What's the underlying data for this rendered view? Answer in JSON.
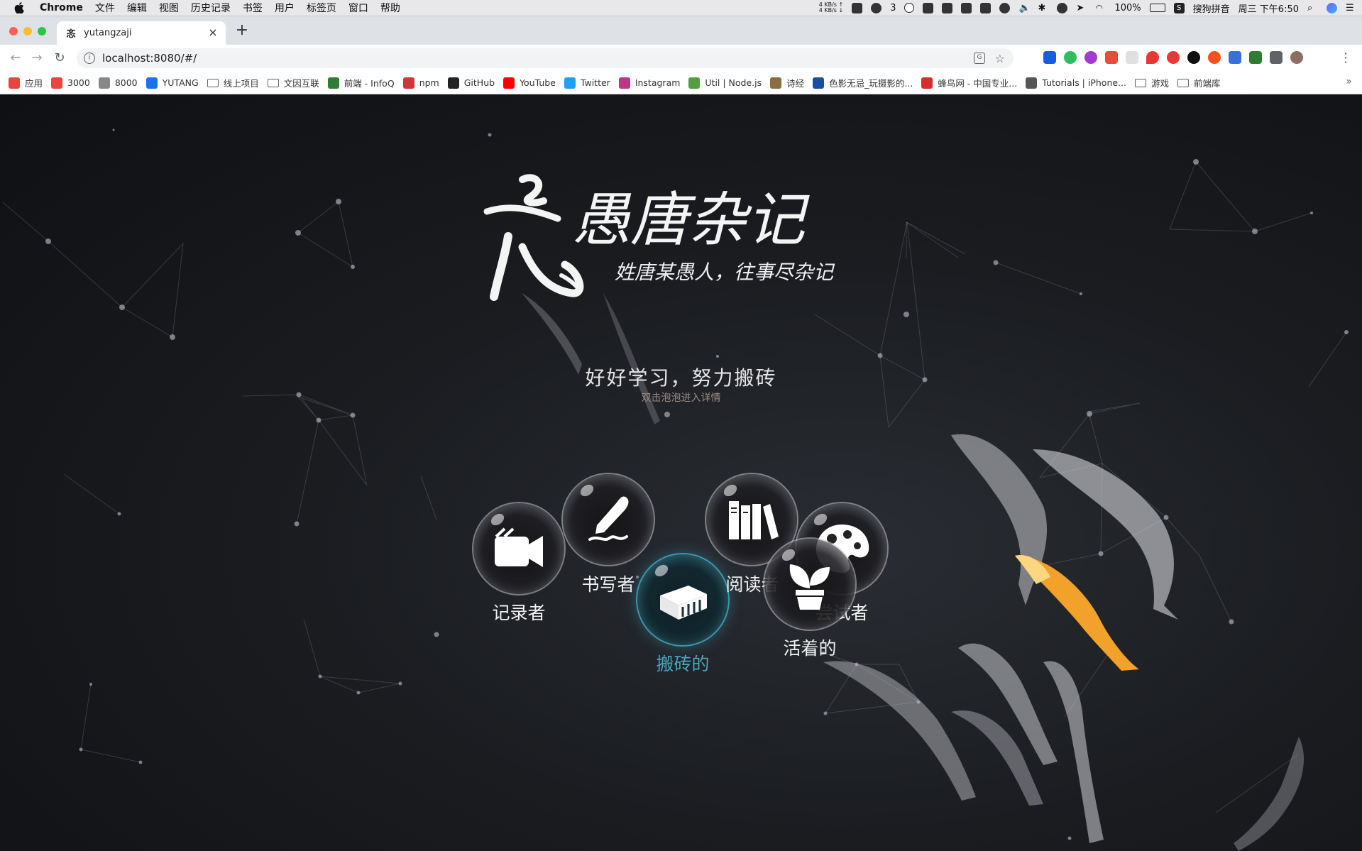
{
  "menubar": {
    "app": "Chrome",
    "items": [
      "文件",
      "编辑",
      "视图",
      "历史记录",
      "书签",
      "用户",
      "标签页",
      "窗口",
      "帮助"
    ],
    "net_up": "4 KB/s ↑",
    "net_down": "4 KB/s ↓",
    "wechat_count": "3",
    "battery": "100%",
    "input_method": "搜狗拼音",
    "clock": "周三 下午6:50"
  },
  "browser": {
    "tab_title": "yutangzaji",
    "tab_favicon": "忞",
    "url": "localhost:8080/#/"
  },
  "bookmarks": [
    {
      "label": "应用",
      "icon": "apps-grid",
      "color": "#e8453c"
    },
    {
      "label": "3000",
      "icon": "flame",
      "color": "#e8453c"
    },
    {
      "label": "8000",
      "icon": "dash",
      "color": "#888888"
    },
    {
      "label": "YUTANG",
      "icon": "dsm",
      "color": "#1a73e8"
    },
    {
      "label": "线上项目",
      "icon": "folder",
      "color": ""
    },
    {
      "label": "文因互联",
      "icon": "folder",
      "color": ""
    },
    {
      "label": "前端 - InfoQ",
      "icon": "infoq",
      "color": "#2e7d32"
    },
    {
      "label": "npm",
      "icon": "npm",
      "color": "#cb3837"
    },
    {
      "label": "GitHub",
      "icon": "github",
      "color": "#222222"
    },
    {
      "label": "YouTube",
      "icon": "youtube",
      "color": "#ff0000"
    },
    {
      "label": "Twitter",
      "icon": "twitter",
      "color": "#1da1f2"
    },
    {
      "label": "Instagram",
      "icon": "instagram",
      "color": "#c13584"
    },
    {
      "label": "Util | Node.js",
      "icon": "nodejs",
      "color": "#539e43"
    },
    {
      "label": "诗经",
      "icon": "poem",
      "color": "#8a6d3b"
    },
    {
      "label": "色影无忌_玩摄影的...",
      "icon": "xitek",
      "color": "#1a4fa0"
    },
    {
      "label": "蜂鸟网 - 中国专业...",
      "icon": "fengniao",
      "color": "#d32f2f"
    },
    {
      "label": "Tutorials | iPhone...",
      "icon": "tutorials",
      "color": "#555555"
    },
    {
      "label": "游戏",
      "icon": "folder",
      "color": ""
    },
    {
      "label": "前端库",
      "icon": "folder",
      "color": ""
    }
  ],
  "hero": {
    "logo_title": "愚唐杂记",
    "logo_tagline": "姓唐某愚人，往事尽杂记",
    "headline": "好好学习，努力搬砖",
    "hint": "双击泡泡进入详情"
  },
  "bubbles": [
    {
      "id": "recorder",
      "label": "记录者",
      "icon": "video-camera-icon",
      "active": false
    },
    {
      "id": "writer",
      "label": "书写者",
      "icon": "pen-signature-icon",
      "active": false
    },
    {
      "id": "brick",
      "label": "搬砖的",
      "icon": "brick-icon",
      "active": true
    },
    {
      "id": "reader",
      "label": "阅读者",
      "icon": "books-icon",
      "active": false
    },
    {
      "id": "trier",
      "label": "尝试者",
      "icon": "palette-icon",
      "active": false
    },
    {
      "id": "living",
      "label": "活着的",
      "icon": "sprout-pot-icon",
      "active": false
    }
  ],
  "colors": {
    "accent_active": "#4aa6be",
    "koi_orange": "#f2a12a",
    "page_bg": "#121418"
  }
}
